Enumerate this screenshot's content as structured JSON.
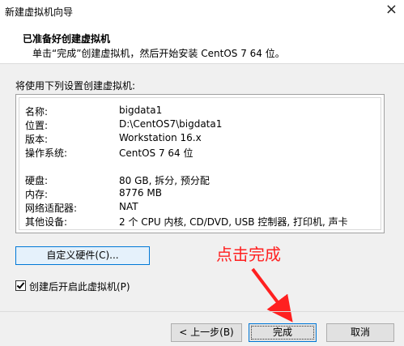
{
  "window": {
    "title": "新建虚拟机向导",
    "close_glyph": "×"
  },
  "header": {
    "title": "已准备好创建虚拟机",
    "subtitle": "单击“完成”创建虚拟机，然后开始安装 CentOS 7 64 位。"
  },
  "summary": {
    "label": "将使用下列设置创建虚拟机:",
    "rows": [
      {
        "key": "名称:",
        "value": "bigdata1"
      },
      {
        "key": "位置:",
        "value": "D:\\CentOS7\\bigdata1"
      },
      {
        "key": "版本:",
        "value": "Workstation 16.x"
      },
      {
        "key": "操作系统:",
        "value": "CentOS 7 64 位"
      },
      {
        "key": "硬盘:",
        "value": "80 GB, 拆分, 预分配"
      },
      {
        "key": "内存:",
        "value": "8776 MB"
      },
      {
        "key": "网络适配器:",
        "value": "NAT"
      },
      {
        "key": "其他设备:",
        "value": "2 个 CPU 内核, CD/DVD, USB 控制器, 打印机, 声卡"
      }
    ]
  },
  "customize_button": {
    "label": "自定义硬件(C)..."
  },
  "power_on_checkbox": {
    "label": "创建后开启此虚拟机(P)",
    "checked": true
  },
  "annotation": {
    "text": "点击完成",
    "color": "#ff2020"
  },
  "footer": {
    "back_label": "< 上一步(B)",
    "finish_label": "完成",
    "cancel_label": "取消"
  }
}
